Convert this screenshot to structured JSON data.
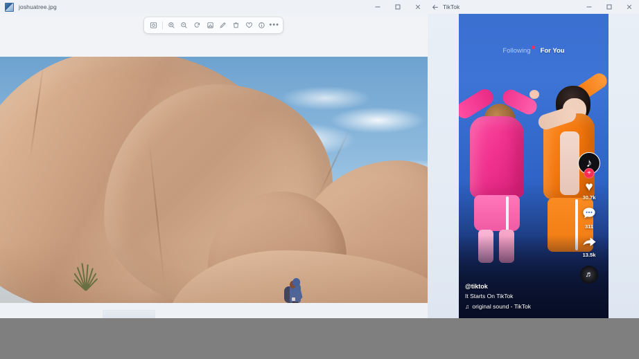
{
  "photos_window": {
    "title": "joshuatree.jpg",
    "file_icon": "image-file-icon",
    "window_controls": {
      "minimize": "–",
      "maximize": "☐",
      "close": "✕"
    },
    "toolbar": {
      "items": [
        {
          "name": "slideshow-icon",
          "label": "Slideshow"
        },
        {
          "name": "zoom-in-icon",
          "label": "Zoom in"
        },
        {
          "name": "zoom-out-icon",
          "label": "Zoom out"
        },
        {
          "name": "rotate-icon",
          "label": "Rotate"
        },
        {
          "name": "crop-icon",
          "label": "Crop"
        },
        {
          "name": "markup-pen-icon",
          "label": "Markup"
        },
        {
          "name": "delete-icon",
          "label": "Delete"
        },
        {
          "name": "favorite-heart-icon",
          "label": "Add to favorites"
        },
        {
          "name": "info-icon",
          "label": "File info"
        }
      ],
      "more_label": "•••"
    },
    "photo": {
      "alt": "Joshua Tree desert rock formations with a hiker",
      "scene_colors": {
        "rock": "#cda284",
        "sky": "#8cb9dd",
        "hiker_jacket": "#3f63a8"
      }
    }
  },
  "tiktok_window": {
    "title": "TikTok",
    "back_icon": "back-arrow-icon",
    "window_controls": {
      "minimize": "–",
      "maximize": "☐",
      "close": "✕"
    },
    "tabs": [
      {
        "label": "Following",
        "active": false,
        "has_dot": true
      },
      {
        "label": "For You",
        "active": true,
        "has_dot": false
      }
    ],
    "rail": [
      {
        "name": "profile-avatar",
        "icon": "♪",
        "follow_label": "+",
        "count": ""
      },
      {
        "name": "like-button",
        "icon": "♥",
        "count": "30.7k"
      },
      {
        "name": "comment-button",
        "icon": "●●●",
        "count": "311"
      },
      {
        "name": "share-button",
        "icon": "➤",
        "count": "13.5k"
      },
      {
        "name": "music-disc",
        "icon": "♬",
        "count": ""
      }
    ],
    "caption": {
      "username": "@tiktok",
      "text": "It Starts On TikTok",
      "music_note": "♫",
      "music": "original sound - TikTok"
    },
    "accent_color": "#fe2c55"
  }
}
